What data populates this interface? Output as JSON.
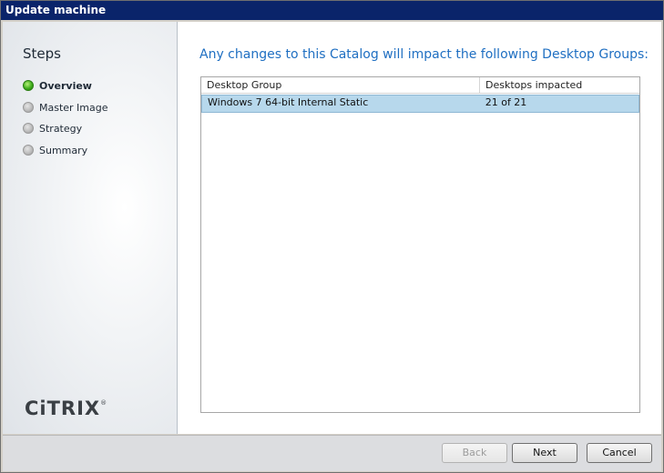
{
  "window": {
    "title": "Update machine"
  },
  "sidebar": {
    "heading": "Steps",
    "steps": [
      {
        "label": "Overview",
        "state": "active"
      },
      {
        "label": "Master Image",
        "state": "inactive"
      },
      {
        "label": "Strategy",
        "state": "inactive"
      },
      {
        "label": "Summary",
        "state": "inactive"
      }
    ],
    "logo_text": "CiTRIX",
    "logo_mark": "®"
  },
  "main": {
    "heading": "Any changes to this Catalog will impact the following Desktop Groups:",
    "table": {
      "columns": [
        "Desktop Group",
        "Desktops impacted"
      ],
      "rows": [
        [
          "Windows 7 64-bit Internal Static",
          "21 of 21"
        ]
      ]
    }
  },
  "footer": {
    "back_label": "Back",
    "next_label": "Next",
    "cancel_label": "Cancel"
  },
  "colors": {
    "title_bar": "#0a246a",
    "heading": "#1f6fc2",
    "selected_row": "#b7d8ec",
    "active_step": "#3fae1c"
  }
}
